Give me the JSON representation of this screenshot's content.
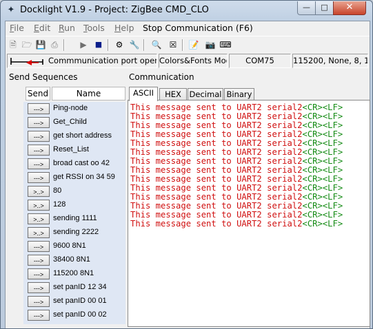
{
  "window": {
    "title": "Docklight V1.9 - Project: ZigBee CMD_CLO",
    "minimize": "—",
    "maximize": "□",
    "close": "✕"
  },
  "menu": {
    "file": "File",
    "edit": "Edit",
    "run": "Run",
    "tools": "Tools",
    "help": "Help",
    "stop_communication": "Stop Communication  (F6)"
  },
  "toolbar": {
    "icons": [
      "new-file-icon",
      "open-folder-icon",
      "save-icon",
      "print-icon",
      "run-icon",
      "stop-icon",
      "project-settings-icon",
      "wrench-icon",
      "find-icon",
      "clear-icon",
      "edit-notes-icon",
      "camera-icon",
      "keyboard-icon"
    ]
  },
  "status": {
    "port_state": "Commmunication port open",
    "colors_fonts": "Colors&Fonts Mode",
    "com_port": "COM75",
    "settings": "115200, None, 8, 1"
  },
  "send_sequences": {
    "title": "Send Sequences",
    "col_send": "Send",
    "col_name": "Name",
    "items": [
      {
        "button": "--->",
        "name": "Ping-node"
      },
      {
        "button": "--->",
        "name": "Get_Child"
      },
      {
        "button": "--->",
        "name": "get short address"
      },
      {
        "button": "--->",
        "name": "Reset_List"
      },
      {
        "button": "--->",
        "name": "broad cast oo 42"
      },
      {
        "button": "--->",
        "name": "get RSSI on 34 59"
      },
      {
        "button": ">..>",
        "name": "80"
      },
      {
        "button": ">..>",
        "name": "128"
      },
      {
        "button": ">..>",
        "name": "sending 1111"
      },
      {
        "button": ">..>",
        "name": "sending 2222"
      },
      {
        "button": "--->",
        "name": " 9600 8N1"
      },
      {
        "button": "--->",
        "name": "38400 8N1"
      },
      {
        "button": "--->",
        "name": "115200 8N1"
      },
      {
        "button": "--->",
        "name": "set panID 12 34"
      },
      {
        "button": "--->",
        "name": "set panID 00 01"
      },
      {
        "button": "--->",
        "name": "set panID 00 02"
      }
    ]
  },
  "communication": {
    "title": "Communication",
    "tabs": [
      "ASCII",
      "HEX",
      "Decimal",
      "Binary"
    ],
    "active_tab": "ASCII",
    "lines": [
      {
        "text": "This message sent to UART2 serial2",
        "ctrl": "<CR><LF>"
      },
      {
        "text": "This message sent to UART2 serial2",
        "ctrl": "<CR><LF>"
      },
      {
        "text": "This message sent to UART2 serial2",
        "ctrl": "<CR><LF>"
      },
      {
        "text": "This message sent to UART2 serial2",
        "ctrl": "<CR><LF>"
      },
      {
        "text": "This message sent to UART2 serial2",
        "ctrl": "<CR><LF>"
      },
      {
        "text": "This message sent to UART2 serial2",
        "ctrl": "<CR><LF>"
      },
      {
        "text": "This message sent to UART2 serial2",
        "ctrl": "<CR><LF>"
      },
      {
        "text": "This message sent to UART2 serial2",
        "ctrl": "<CR><LF>"
      },
      {
        "text": "This message sent to UART2 serial2",
        "ctrl": "<CR><LF>"
      },
      {
        "text": "This message sent to UART2 serial2",
        "ctrl": "<CR><LF>"
      },
      {
        "text": "This message sent to UART2 serial2",
        "ctrl": "<CR><LF>"
      },
      {
        "text": "This message sent to UART2 serial2",
        "ctrl": "<CR><LF>"
      },
      {
        "text": "This message sent to UART2 serial2",
        "ctrl": "<CR><LF>"
      },
      {
        "text": "This message sent to UART2 serial2",
        "ctrl": "<CR><LF>"
      }
    ]
  },
  "colors": {
    "sent_text": "#d01010",
    "control_chars": "#138a13",
    "sequence_bg": "#dfe7f4"
  }
}
